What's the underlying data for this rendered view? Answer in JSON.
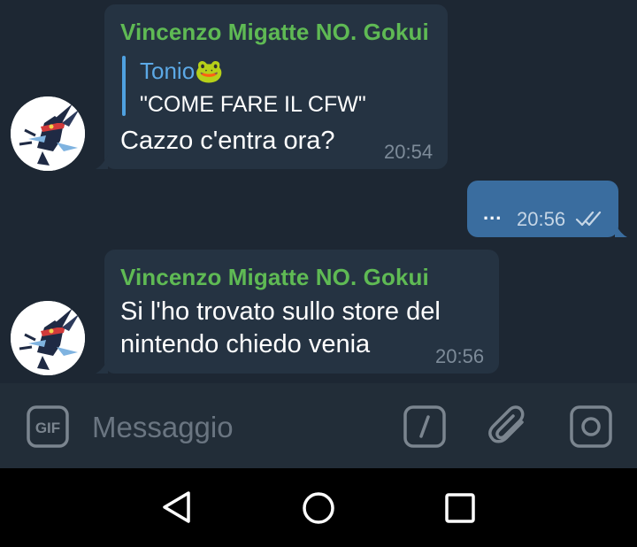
{
  "messages": [
    {
      "sender": "Vincenzo Migatte NO. Gokui",
      "reply": {
        "name": "Tonio",
        "emoji": "🐸",
        "text": "\"COME FARE IL CFW\""
      },
      "text": "Cazzo c'entra ora?",
      "time": "20:54"
    },
    {
      "outgoing": true,
      "text": "...",
      "time": "20:56",
      "status": "double-check-icon"
    },
    {
      "sender": "Vincenzo Migatte NO. Gokui",
      "lines": [
        "Si l'ho trovato sullo store del",
        "nintendo chiedo venia"
      ],
      "time": "20:56"
    }
  ],
  "composer": {
    "placeholder": "Messaggio",
    "icons": [
      "gif-icon",
      "slash-command-icon",
      "paperclip-icon",
      "camera-icon"
    ]
  },
  "navigation": {
    "icons": [
      "back-triangle-icon",
      "home-circle-icon",
      "recents-square-icon"
    ]
  },
  "colors": {
    "background": "#1d2733",
    "incoming_bubble": "#253342",
    "outgoing_bubble": "#3a6d9f",
    "sender_name": "#5fba54",
    "reply_accent": "#4fa1e0",
    "input_bar": "#222d38"
  }
}
